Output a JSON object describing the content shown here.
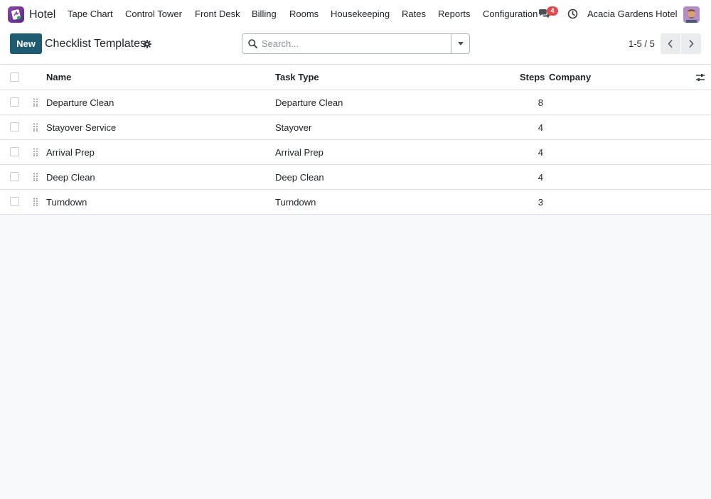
{
  "app": {
    "name": "Hotel"
  },
  "nav": {
    "menu": [
      {
        "label": "Tape Chart"
      },
      {
        "label": "Control Tower"
      },
      {
        "label": "Front Desk"
      },
      {
        "label": "Billing"
      },
      {
        "label": "Rooms"
      },
      {
        "label": "Housekeeping"
      },
      {
        "label": "Rates"
      },
      {
        "label": "Reports"
      },
      {
        "label": "Configuration"
      }
    ],
    "messages_badge": "4",
    "company": "Acacia Gardens Hotel"
  },
  "control_panel": {
    "new_label": "New",
    "title": "Checklist Templates",
    "search_placeholder": "Search...",
    "pager": "1-5 / 5"
  },
  "table": {
    "headers": {
      "name": "Name",
      "task_type": "Task Type",
      "steps": "Steps",
      "company": "Company"
    },
    "rows": [
      {
        "name": "Departure Clean",
        "task_type": "Departure Clean",
        "steps": "8",
        "company": ""
      },
      {
        "name": "Stayover Service",
        "task_type": "Stayover",
        "steps": "4",
        "company": ""
      },
      {
        "name": "Arrival Prep",
        "task_type": "Arrival Prep",
        "steps": "4",
        "company": ""
      },
      {
        "name": "Deep Clean",
        "task_type": "Deep Clean",
        "steps": "4",
        "company": ""
      },
      {
        "name": "Turndown",
        "task_type": "Turndown",
        "steps": "3",
        "company": ""
      }
    ]
  },
  "colors": {
    "primary": "#1f5a73",
    "badge": "#e04c4c",
    "app_icon": "#8e44ad"
  }
}
